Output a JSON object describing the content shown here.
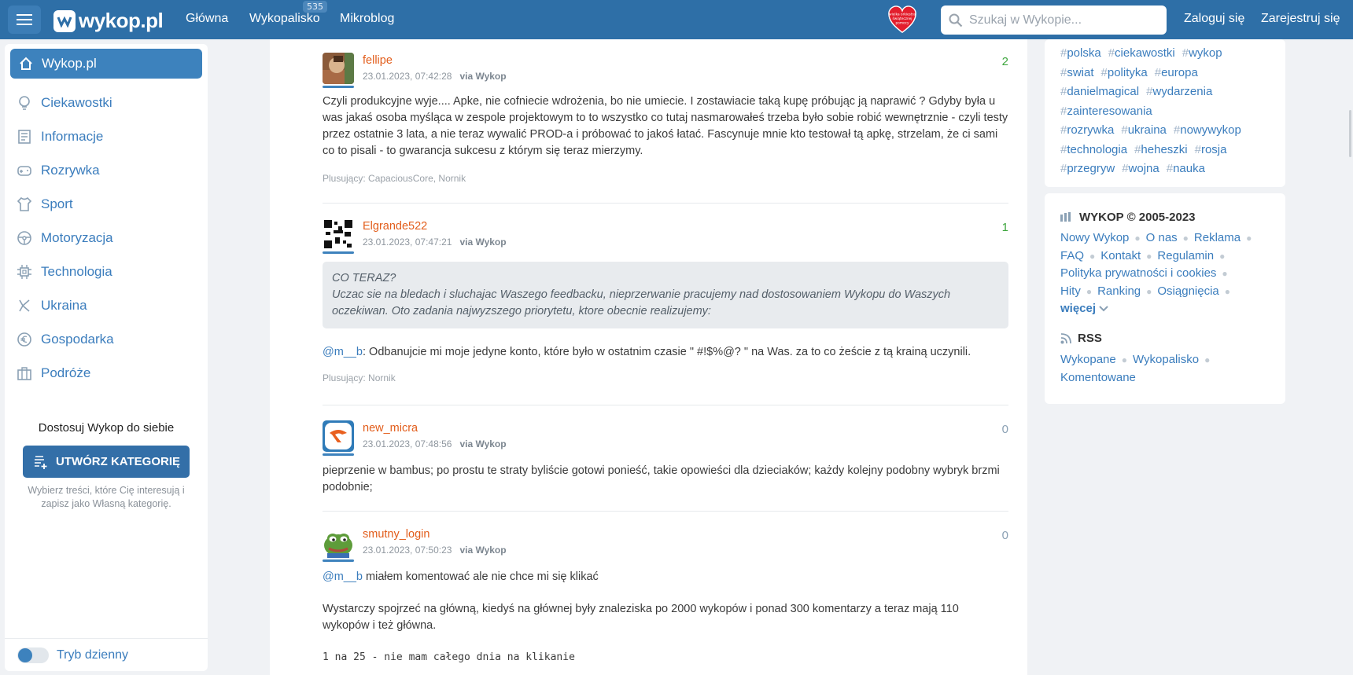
{
  "topbar": {
    "logo": "wykop.pl",
    "nav": [
      {
        "label": "Główna"
      },
      {
        "label": "Wykopalisko",
        "badge": "535"
      },
      {
        "label": "Mikroblog"
      }
    ],
    "search_placeholder": "Szukaj w Wykopie...",
    "login": "Zaloguj się",
    "register": "Zarejestruj się",
    "heart_badge_text": "wielka orkiestra świątecznej pomocy",
    "brand_color": "#2e6fa7"
  },
  "sidebar": {
    "home": "Wykop.pl",
    "items": [
      {
        "label": "Ciekawostki",
        "icon": "bulb-icon"
      },
      {
        "label": "Informacje",
        "icon": "newspaper-icon"
      },
      {
        "label": "Rozrywka",
        "icon": "gamepad-icon"
      },
      {
        "label": "Sport",
        "icon": "shirt-icon"
      },
      {
        "label": "Motoryzacja",
        "icon": "steering-wheel-icon"
      },
      {
        "label": "Technologia",
        "icon": "chip-icon"
      },
      {
        "label": "Ukraina",
        "icon": "ukraine-icon"
      },
      {
        "label": "Gospodarka",
        "icon": "euro-icon"
      },
      {
        "label": "Podróże",
        "icon": "suitcase-icon"
      }
    ],
    "customize_title": "Dostosuj Wykop do siebie",
    "create_button": "UTWÓRZ KATEGORIĘ",
    "customize_desc": "Wybierz treści, które Cię interesują i zapisz jako Własną kategorię.",
    "theme_toggle": "Tryb dzienny"
  },
  "comments": [
    {
      "author": "fellipe",
      "date": "23.01.2023, 07:42:28",
      "via": "via Wykop",
      "score": "2",
      "body": "Czyli produkcyjne wyje.... Apke, nie cofniecie wdrożenia, bo nie umiecie. I zostawiacie taką kupę próbując ją naprawić ? Gdyby była u was jakaś osoba myśląca w zespole projektowym to to wszystko co tutaj nasmarowałeś trzeba było sobie robić wewnętrznie - czyli testy przez ostatnie 3 lata, a nie teraz wywalić PROD-a i próbować to jakoś łatać. Fascynuje mnie kto testował tą apkę, strzelam, że ci sami co to pisali - to gwarancja sukcesu z którym się teraz mierzymy.",
      "plus": "Plusujący: CapaciousCore, Nornik"
    },
    {
      "author": "Elgrande522",
      "date": "23.01.2023, 07:47:21",
      "via": "via Wykop",
      "score": "1",
      "quote_line1": "CO TERAZ?",
      "quote_line2": "Uczac sie na bledach i sluchajac Waszego feedbacku, nieprzerwanie pracujemy nad dostosowaniem Wykopu do Waszych oczekiwan. Oto zadania najwyzszego priorytetu, ktore obecnie realizujemy:",
      "mention": "@m__b",
      "body": ": Odbanujcie mi moje jedyne konto, które było w ostatnim czasie \" #!$%@? \" na Was. za to co żeście z tą krainą uczynili.",
      "plus": "Plusujący: Nornik"
    },
    {
      "author": "new_micra",
      "date": "23.01.2023, 07:48:56",
      "via": "via Wykop",
      "score": "0",
      "body": "pieprzenie w bambus; po prostu te straty byliście gotowi ponieść, takie opowieści dla dzieciaków; każdy kolejny podobny wybryk brzmi podobnie;"
    },
    {
      "author": "smutny_login",
      "date": "23.01.2023, 07:50:23",
      "via": "via Wykop",
      "score": "0",
      "mention": "@m__b",
      "body1": " miałem komentować ale nie chce mi się klikać",
      "body2": "Wystarczy spojrzeć na główną, kiedyś na głównej były znaleziska po 2000 wykopów i ponad 300 komentarzy a teraz mają 110 wykopów i też główna.",
      "code": "1 na 25 - nie mam całego dnia na klikanie"
    }
  ],
  "tags": [
    "polska",
    "ciekawostki",
    "wykop",
    "swiat",
    "polityka",
    "europa",
    "danielmagical",
    "wydarzenia",
    "zainteresowania",
    "rozrywka",
    "ukraina",
    "nowywykop",
    "technologia",
    "heheszki",
    "rosja",
    "przegryw",
    "wojna",
    "nauka"
  ],
  "footer": {
    "title": "WYKOP © 2005-2023",
    "links": [
      "Nowy Wykop",
      "O nas",
      "Reklama",
      "FAQ",
      "Kontakt",
      "Regulamin",
      "Polityka prywatności i cookies",
      "Hity",
      "Ranking",
      "Osiągnięcia"
    ],
    "more": "więcej",
    "rss_title": "RSS",
    "rss_links": [
      "Wykopane",
      "Wykopalisko",
      "Komentowane"
    ]
  },
  "colors": {
    "score_positive": "#3ea63e",
    "score_neutral": "#8aa0b4",
    "author": "#e25d1b",
    "link": "#3b7dbd"
  }
}
